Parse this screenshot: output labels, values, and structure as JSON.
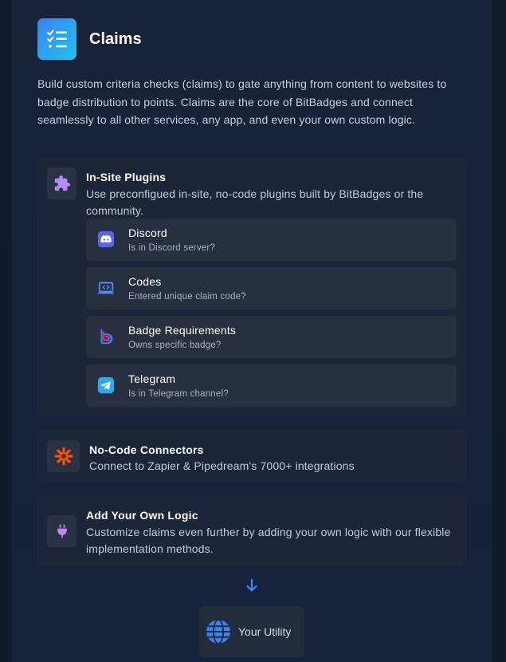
{
  "header": {
    "title": "Claims",
    "intro": "Build custom criteria checks (claims) to gate anything from content to websites to badge distribution to points. Claims are the core of BitBadges and connect seamlessly to all other services, any app, and even your own custom logic."
  },
  "in_site_plugins": {
    "title": "In-Site Plugins",
    "description": "Use preconfigued in-site, no-code plugins built by BitBadges or the community.",
    "items": [
      {
        "name": "Discord",
        "description": "Is in Discord server?",
        "icon": "discord-icon"
      },
      {
        "name": "Codes",
        "description": "Entered unique claim code?",
        "icon": "code-laptop-icon"
      },
      {
        "name": "Badge Requirements",
        "description": "Owns specific badge?",
        "icon": "bitbadges-icon"
      },
      {
        "name": "Telegram",
        "description": "Is in Telegram channel?",
        "icon": "telegram-icon"
      }
    ]
  },
  "no_code_connectors": {
    "title": "No-Code Connectors",
    "description": "Connect to Zapier & Pipedream's 7000+ integrations",
    "icon": "zapier-icon"
  },
  "own_logic": {
    "title": "Add Your Own Logic",
    "description": "Customize claims even further by adding your own logic with our flexible implementation methods.",
    "icon": "plug-icon"
  },
  "utility": {
    "label": "Your Utility",
    "icon": "globe-icon"
  },
  "colors": {
    "accent": "#3b82f6",
    "purple": "#a78bfa",
    "zapier_orange": "#ff4f00",
    "discord": "#5865f2",
    "telegram": "#2aabee"
  }
}
